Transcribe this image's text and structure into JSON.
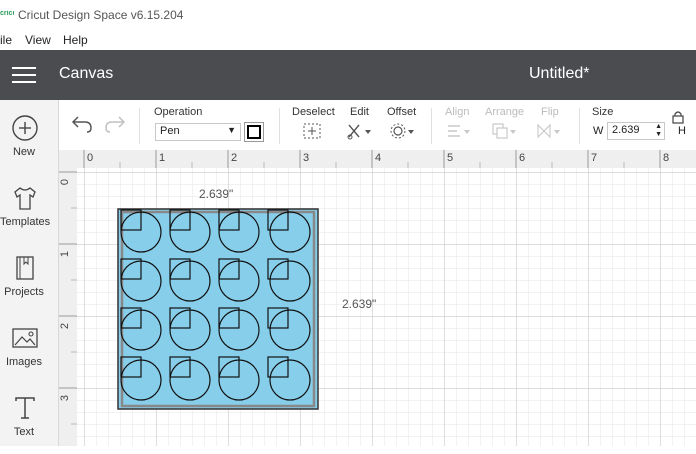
{
  "window": {
    "title": "Cricut Design Space  v6.15.204"
  },
  "menu": {
    "file": "ile",
    "view": "View",
    "help": "Help"
  },
  "header": {
    "section": "Canvas",
    "document_title": "Untitled*"
  },
  "sidebar": {
    "items": [
      {
        "label": "New",
        "icon": "plus-circle-icon"
      },
      {
        "label": "Templates",
        "icon": "shirt-icon"
      },
      {
        "label": "Projects",
        "icon": "book-icon"
      },
      {
        "label": "Images",
        "icon": "image-icon"
      },
      {
        "label": "Text",
        "icon": "text-icon"
      }
    ]
  },
  "toolbar": {
    "operation_label": "Operation",
    "operation_value": "Pen",
    "deselect_label": "Deselect",
    "edit_label": "Edit",
    "offset_label": "Offset",
    "align_label": "Align",
    "arrange_label": "Arrange",
    "flip_label": "Flip",
    "size_label": "Size",
    "width_label": "W",
    "width_value": "2.639",
    "height_label": "H"
  },
  "rulers": {
    "top": [
      "0",
      "1",
      "2",
      "3",
      "4",
      "5",
      "6",
      "7",
      "8"
    ],
    "left": [
      "0",
      "1",
      "2",
      "3"
    ]
  },
  "canvas": {
    "width_dimension": "2.639\"",
    "height_dimension": "2.639\"",
    "design_fill": "#87ceeb",
    "design_rows": 4,
    "design_cols": 4
  },
  "colors": {
    "header": "#4a4c50",
    "accent": "#2a9d5c"
  }
}
